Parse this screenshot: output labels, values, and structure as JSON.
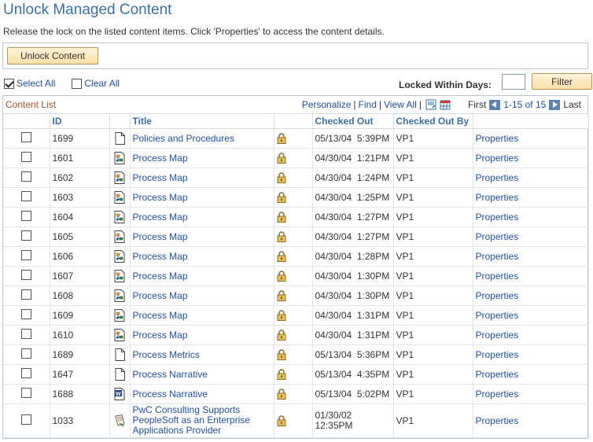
{
  "page": {
    "title": "Unlock Managed Content",
    "instructions": "Release the lock on the listed content items.  Click 'Properties' to access the content details."
  },
  "actions": {
    "unlock_label": "Unlock Content",
    "select_all_label": "Select All",
    "clear_all_label": "Clear All",
    "locked_within_label": "Locked Within Days:",
    "locked_within_value": "",
    "filter_label": "Filter"
  },
  "grid": {
    "caption": "Content List",
    "personalize": "Personalize",
    "find": "Find",
    "view_all": "View All",
    "first": "First",
    "range": "1-15 of 15",
    "last": "Last",
    "columns": {
      "id": "ID",
      "title": "Title",
      "checked_out": "Checked Out",
      "checked_out_by": "Checked Out By"
    },
    "rows": [
      {
        "id": "1699",
        "icon": "document-icon",
        "title": "Policies and Procedures",
        "checked_out": "05/13/04  5:39PM",
        "by": "VP1",
        "link": "Properties"
      },
      {
        "id": "1601",
        "icon": "process-map-icon",
        "title": "Process Map",
        "checked_out": "04/30/04  1:21PM",
        "by": "VP1",
        "link": "Properties"
      },
      {
        "id": "1602",
        "icon": "process-map-icon",
        "title": "Process Map",
        "checked_out": "04/30/04  1:24PM",
        "by": "VP1",
        "link": "Properties"
      },
      {
        "id": "1603",
        "icon": "process-map-icon",
        "title": "Process Map",
        "checked_out": "04/30/04  1:25PM",
        "by": "VP1",
        "link": "Properties"
      },
      {
        "id": "1604",
        "icon": "process-map-icon",
        "title": "Process Map",
        "checked_out": "04/30/04  1:27PM",
        "by": "VP1",
        "link": "Properties"
      },
      {
        "id": "1605",
        "icon": "process-map-icon",
        "title": "Process Map",
        "checked_out": "04/30/04  1:27PM",
        "by": "VP1",
        "link": "Properties"
      },
      {
        "id": "1606",
        "icon": "process-map-icon",
        "title": "Process Map",
        "checked_out": "04/30/04  1:28PM",
        "by": "VP1",
        "link": "Properties"
      },
      {
        "id": "1607",
        "icon": "process-map-icon",
        "title": "Process Map",
        "checked_out": "04/30/04  1:30PM",
        "by": "VP1",
        "link": "Properties"
      },
      {
        "id": "1608",
        "icon": "process-map-icon",
        "title": "Process Map",
        "checked_out": "04/30/04  1:30PM",
        "by": "VP1",
        "link": "Properties"
      },
      {
        "id": "1609",
        "icon": "process-map-icon",
        "title": "Process Map",
        "checked_out": "04/30/04  1:31PM",
        "by": "VP1",
        "link": "Properties"
      },
      {
        "id": "1610",
        "icon": "process-map-icon",
        "title": "Process Map",
        "checked_out": "04/30/04  1:31PM",
        "by": "VP1",
        "link": "Properties"
      },
      {
        "id": "1689",
        "icon": "document-icon",
        "title": "Process Metrics",
        "checked_out": "05/13/04  5:36PM",
        "by": "VP1",
        "link": "Properties"
      },
      {
        "id": "1647",
        "icon": "document-icon",
        "title": "Process Narrative",
        "checked_out": "05/13/04  4:35PM",
        "by": "VP1",
        "link": "Properties"
      },
      {
        "id": "1688",
        "icon": "word-doc-icon",
        "title": "Process Narrative",
        "checked_out": "05/13/04  5:02PM",
        "by": "VP1",
        "link": "Properties"
      },
      {
        "id": "1033",
        "icon": "article-icon",
        "title": "PwC Consulting Supports PeopleSoft as an Enterprise Applications Provider",
        "checked_out": "01/30/02 12:35PM",
        "by": "VP1",
        "link": "Properties"
      }
    ]
  }
}
